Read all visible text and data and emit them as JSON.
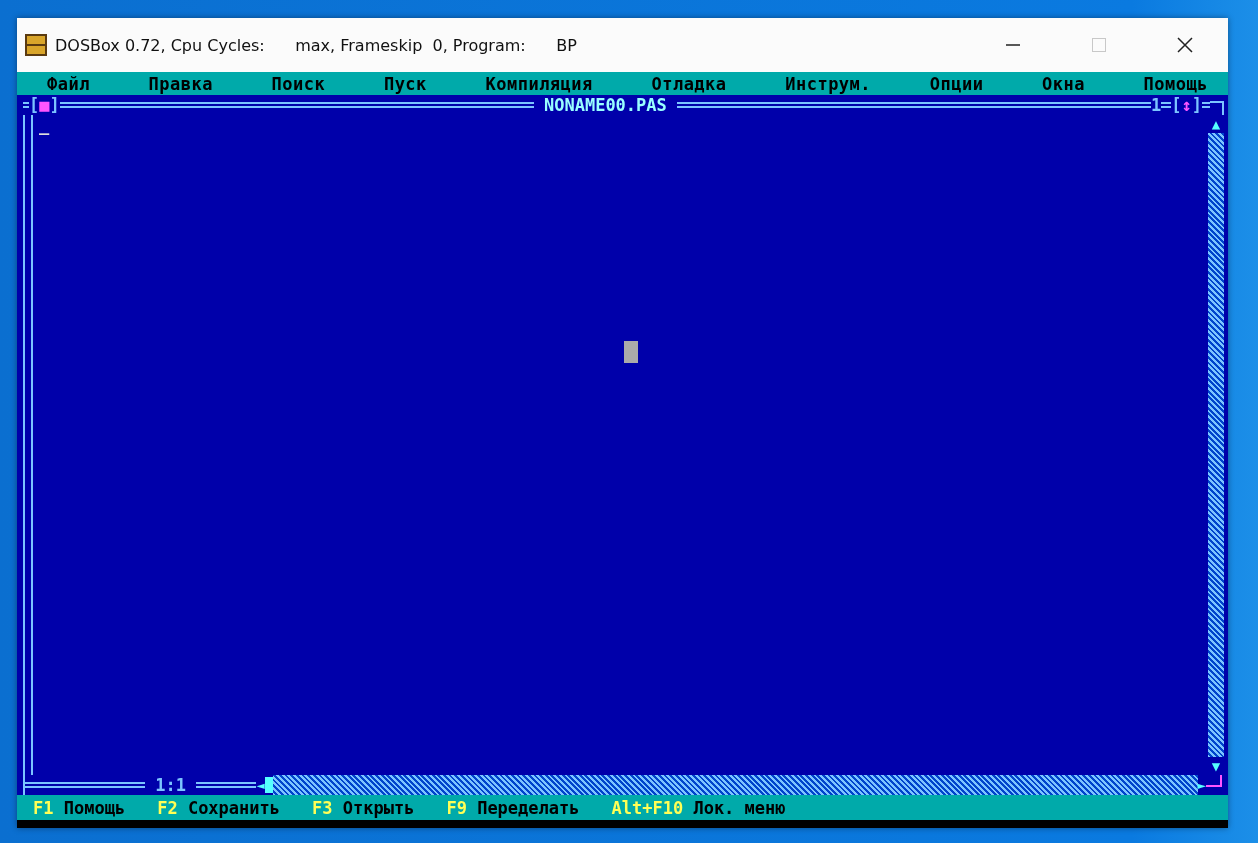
{
  "window": {
    "title": "DOSBox 0.72, Cpu Cycles:      max, Frameskip  0, Program:      BP",
    "controls": [
      {
        "kind": "minimize",
        "disabled": false
      },
      {
        "kind": "maximize",
        "disabled": true
      },
      {
        "kind": "close",
        "disabled": false
      }
    ]
  },
  "menu": [
    "Файл",
    "Правка",
    "Поиск",
    "Пуск",
    "Компиляция",
    "Отладка",
    "Инструм.",
    "Опции",
    "Окна",
    "Помощь"
  ],
  "editor": {
    "close_box": {
      "left": "[",
      "mark": "■",
      "right": "]"
    },
    "file_name": "NONAME00.PAS",
    "window_number": "1",
    "zoom_box": {
      "left": "[",
      "mark": "↕",
      "right": "]"
    },
    "text_cursor": "_",
    "position": "1:1",
    "scroll_up": "▲",
    "scroll_down": "▼",
    "scroll_left": "◄",
    "scroll_right": "►"
  },
  "status_bar": [
    {
      "key": "F1",
      "label": "Помощь"
    },
    {
      "key": "F2",
      "label": "Сохранить"
    },
    {
      "key": "F3",
      "label": "Открыть"
    },
    {
      "key": "F9",
      "label": "Переделать"
    },
    {
      "key": "Alt+F10",
      "label": "Лок. меню"
    }
  ]
}
